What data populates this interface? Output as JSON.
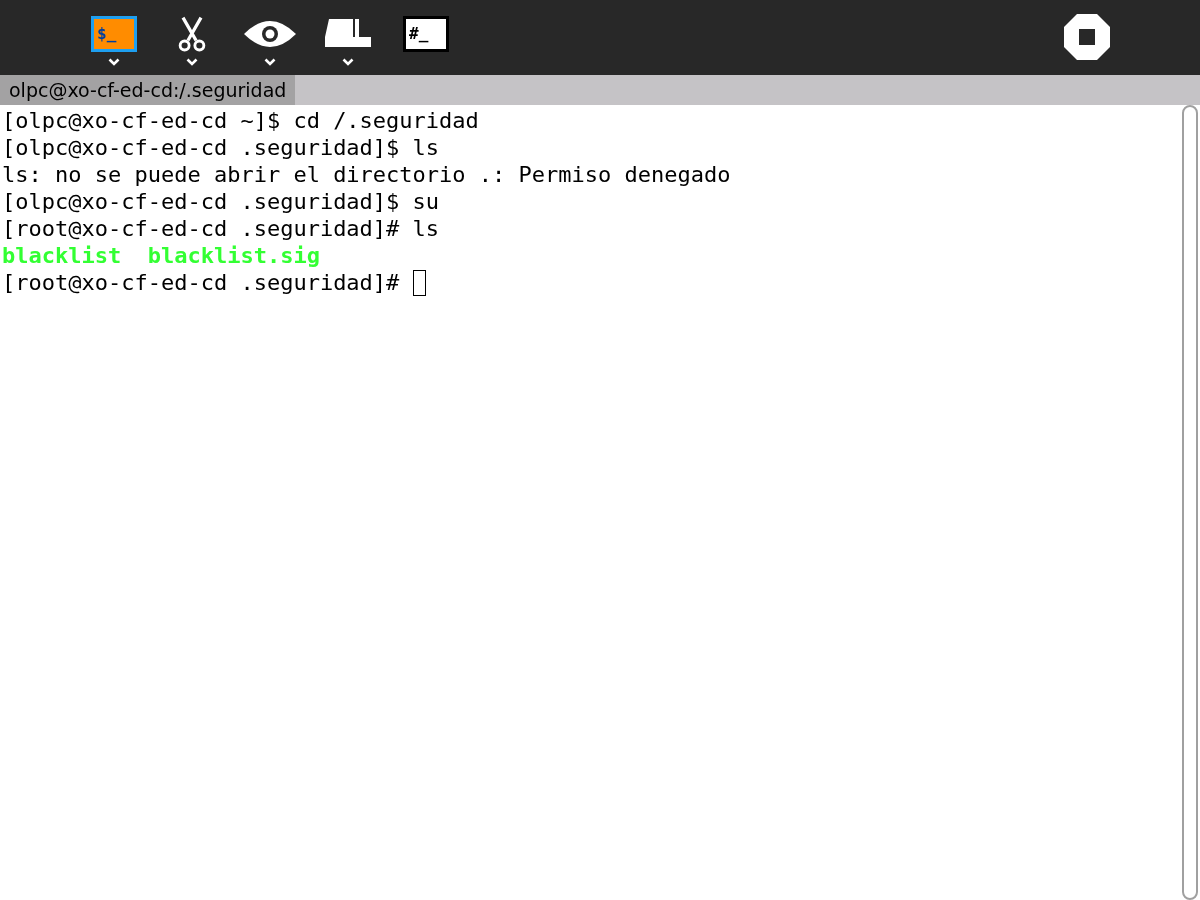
{
  "toolbar": {
    "buttons": [
      {
        "kind": "activity",
        "label": "$_",
        "menu": true
      },
      {
        "kind": "scissors",
        "menu": true
      },
      {
        "kind": "eye",
        "menu": true
      },
      {
        "kind": "keep",
        "menu": true
      },
      {
        "kind": "terminal",
        "label": "#_",
        "menu": false
      }
    ],
    "stop": {
      "kind": "stop"
    }
  },
  "tabs": [
    {
      "label": "olpc@xo-cf-ed-cd:/.seguridad",
      "selected": true
    }
  ],
  "terminal": {
    "lines": [
      {
        "kind": "plain",
        "text": "[olpc@xo-cf-ed-cd ~]$ cd /.seguridad",
        "cursor": false
      },
      {
        "kind": "plain",
        "text": "[olpc@xo-cf-ed-cd .seguridad]$ ls",
        "cursor": false
      },
      {
        "kind": "plain",
        "text": "ls: no se puede abrir el directorio .: Permiso denegado",
        "cursor": false
      },
      {
        "kind": "plain",
        "text": "[olpc@xo-cf-ed-cd .seguridad]$ su",
        "cursor": false
      },
      {
        "kind": "plain",
        "text": "[root@xo-cf-ed-cd .seguridad]# ls",
        "cursor": false
      },
      {
        "kind": "listing",
        "text": "blacklist  blacklist.sig",
        "cursor": false
      },
      {
        "kind": "plain",
        "text": "[root@xo-cf-ed-cd .seguridad]# ",
        "cursor": true
      }
    ]
  }
}
